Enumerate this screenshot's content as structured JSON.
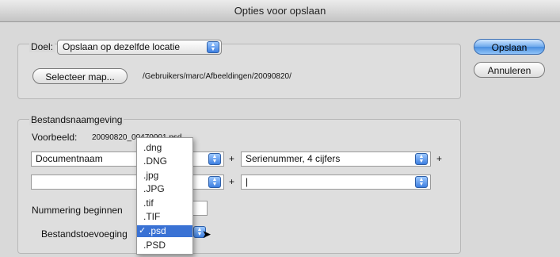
{
  "window": {
    "title": "Opties voor opslaan"
  },
  "buttons": {
    "save": "Opslaan",
    "cancel": "Annuleren"
  },
  "destination": {
    "label": "Doel:",
    "location_value": "Opslaan op dezelfde locatie",
    "select_folder_label": "Selecteer map...",
    "path": "/Gebruikers/marc/Afbeeldingen/20090820/"
  },
  "naming": {
    "title": "Bestandsnaamgeving",
    "example_label": "Voorbeeld:",
    "example_value": "20090820_00470001.psd",
    "row1": {
      "field1": "Documentnaam",
      "plus1": "+",
      "field2": "Serienummer, 4 cijfers",
      "plus2": "+"
    },
    "row2": {
      "field1": "",
      "plus1": "+",
      "field2": "|"
    },
    "start_numbering_label": "Nummering beginnen",
    "extension_label": "Bestandstoevoeging"
  },
  "extension_menu": {
    "items": [
      ".dng",
      ".DNG",
      ".jpg",
      ".JPG",
      ".tif",
      ".TIF",
      ".psd",
      ".PSD"
    ],
    "selected": ".psd",
    "checkmark": "✓"
  },
  "colors": {
    "accent": "#3a72d4",
    "default_button": "#4a8fe0"
  }
}
